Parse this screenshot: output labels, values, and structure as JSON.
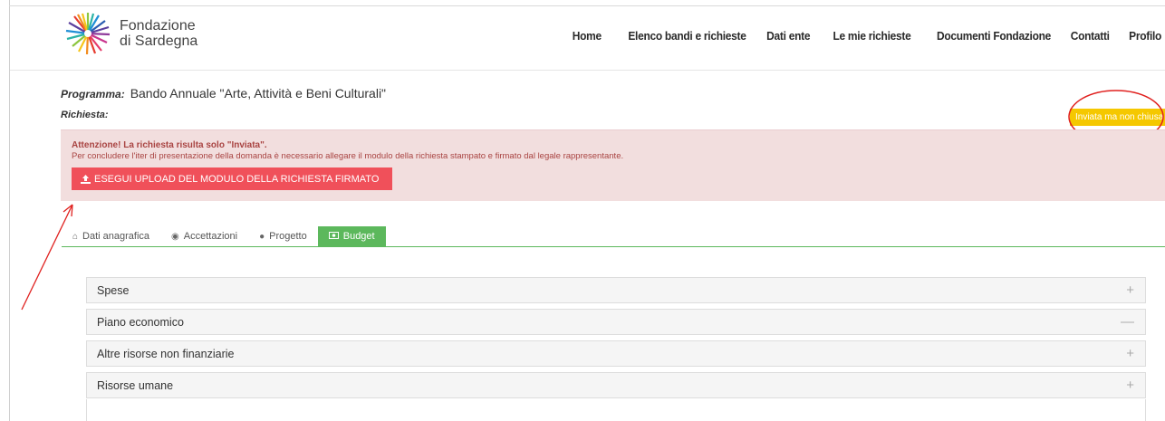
{
  "header": {
    "logo_line1": "Fondazione",
    "logo_line2": "di Sardegna",
    "nav": [
      "Home",
      "Elenco bandi e richieste",
      "Dati ente",
      "Le mie richieste",
      "Documenti Fondazione",
      "Contatti",
      "Profilo"
    ]
  },
  "programma": {
    "label": "Programma:",
    "value": "Bando Annuale \"Arte, Attività e Beni Culturali\""
  },
  "richiesta_label": "Richiesta:",
  "status_badge": "Inviata ma non chiusa",
  "alert": {
    "title": "Attenzione! La richiesta risulta solo \"Inviata\".",
    "text": "Per concludere l'iter di presentazione della domanda è necessario allegare il modulo della richiesta stampato e firmato dal legale rappresentante.",
    "button": "ESEGUI UPLOAD DEL MODULO DELLA RICHIESTA FIRMATO"
  },
  "tabs": [
    {
      "label": "Dati anagrafica",
      "icon": "home-icon"
    },
    {
      "label": "Accettazioni",
      "icon": "eye-icon"
    },
    {
      "label": "Progetto",
      "icon": "globe-icon"
    },
    {
      "label": "Budget",
      "icon": "money-icon",
      "active": true
    }
  ],
  "accordion": [
    {
      "label": "Spese",
      "symbol": "+"
    },
    {
      "label": "Piano economico",
      "symbol": "—"
    },
    {
      "label": "Altre risorse non finanziarie",
      "symbol": "+"
    },
    {
      "label": "Risorse umane",
      "symbol": "+"
    }
  ],
  "colors": {
    "alert_bg": "#f2dede",
    "alert_text": "#a94442",
    "button_red": "#f0505a",
    "tab_green": "#5cb85c",
    "badge_yellow": "#f5c800",
    "annotation_red": "#e0201e"
  }
}
